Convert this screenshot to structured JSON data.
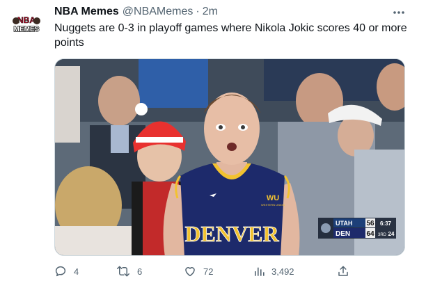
{
  "tweet": {
    "author_name": "NBA Memes",
    "handle": "@NBAMemes",
    "separator": "·",
    "time": "2m",
    "text": "Nuggets are 0-3 in playoff games where Nikola Jokic scores 40 or more points",
    "avatar_text_top": "NBA",
    "avatar_text_bottom": "MEMES"
  },
  "media": {
    "jersey_text": "DENVER",
    "jersey_sponsor_top": "WU",
    "jersey_sponsor_bottom": "WESTERN UNION",
    "scoreboard": {
      "team1": "UTAH",
      "score1": "56",
      "team2": "DEN",
      "score2": "64",
      "clock": "6:37",
      "period": "3RD",
      "shot_clock": "24"
    }
  },
  "actions": {
    "reply_count": "4",
    "retweet_count": "6",
    "like_count": "72",
    "views_count": "3,492"
  },
  "icons": {
    "reply": "reply-icon",
    "retweet": "retweet-icon",
    "like": "like-icon",
    "views": "views-icon",
    "share": "share-icon",
    "more": "more-icon"
  },
  "colors": {
    "text_primary": "#0f1419",
    "text_secondary": "#536471",
    "nuggets_navy": "#1d2a6b",
    "nuggets_gold": "#f2c230"
  }
}
